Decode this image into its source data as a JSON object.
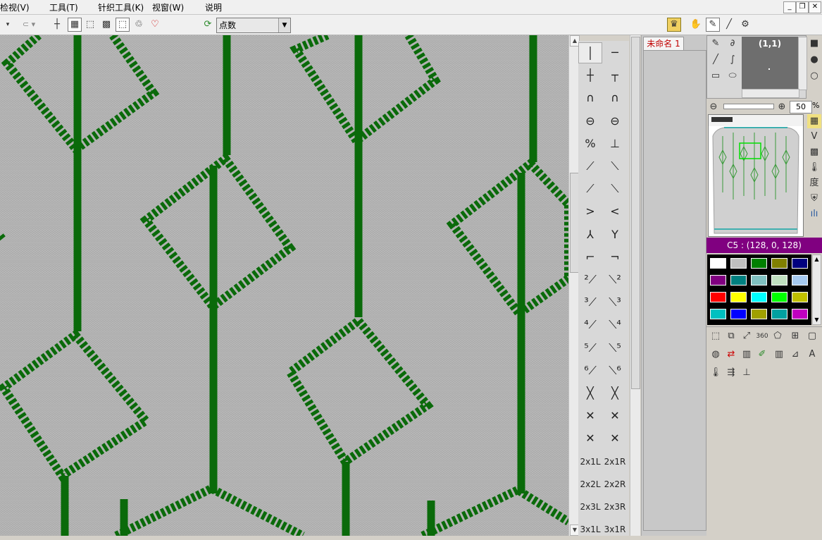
{
  "menu": {
    "items": [
      "检视(V)",
      "工具(T)",
      "针织工具(K)",
      "视窗(W)",
      "说明"
    ]
  },
  "window_controls": {
    "minimize": "_",
    "restore": "❐",
    "close": "✕"
  },
  "toolbar": {
    "mode_select_value": "点数"
  },
  "document": {
    "tab_label": "未命名 1"
  },
  "symbols": [
    [
      "│",
      "─"
    ],
    [
      "┼",
      "┬"
    ],
    [
      "∩",
      "∩"
    ],
    [
      "⊖",
      "⊖"
    ],
    [
      "%",
      "⊥"
    ],
    [
      "⟋",
      "⟍"
    ],
    [
      "⟋",
      "⟍"
    ],
    [
      ">",
      "<"
    ],
    [
      "⅄",
      "Y"
    ],
    [
      "⌐",
      "¬"
    ],
    [
      "²⟋",
      "⟍²"
    ],
    [
      "³⟋",
      "⟍³"
    ],
    [
      "⁴⟋",
      "⟍⁴"
    ],
    [
      "⁵⟋",
      "⟍⁵"
    ],
    [
      "⁶⟋",
      "⟍⁶"
    ],
    [
      "╳",
      "╳"
    ],
    [
      "✕",
      "✕"
    ],
    [
      "✕",
      "✕"
    ],
    [
      "2x1L",
      "2x1R"
    ],
    [
      "2x2L",
      "2x2R"
    ],
    [
      "2x3L",
      "2x3R"
    ],
    [
      "3x1L",
      "3x1R"
    ]
  ],
  "right_panel": {
    "coord_label": "(1,1)",
    "zoom_value": "50",
    "zoom_unit": "%",
    "color_title": "C5 : (128, 0, 128)",
    "side_char": "度",
    "palette": [
      "#ffffff",
      "#c0c0c0",
      "#008000",
      "#808000",
      "#000080",
      "#800080",
      "#008080",
      "#80c0c0",
      "#c0e0c0",
      "#a6caf0",
      "#ff0000",
      "#ffff00",
      "#00ffff",
      "#00ff00",
      "#c0c000",
      "#00c0c0",
      "#0000ff",
      "#a0a000",
      "#00a0a0",
      "#c000c0"
    ]
  },
  "colors": {
    "knit_green": "#0a6a0a",
    "canvas_gray": "#b9b9b9",
    "color_title_bg": "#800080",
    "tab_text": "#c00000"
  },
  "icons": {
    "toolbar": [
      "crosshair-icon",
      "grid-icon",
      "select-rect-icon",
      "pattern-icon",
      "select-icon",
      "lasso-icon",
      "magic-icon"
    ],
    "right_toolbar": [
      "crown-icon",
      "hand-icon",
      "brush-icon",
      "line-icon",
      "stamp-icon"
    ]
  }
}
